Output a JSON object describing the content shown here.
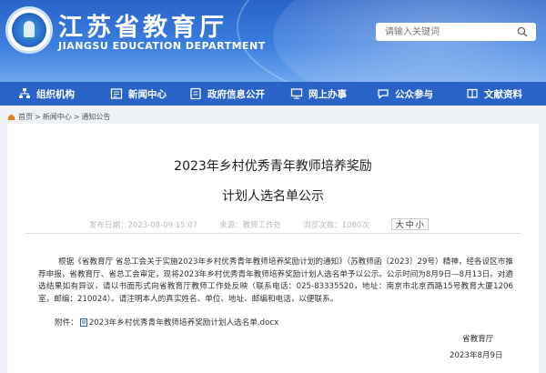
{
  "header": {
    "title": "江苏省教育厅",
    "subtitle": "JIANGSU EDUCATION DEPARTMENT",
    "search_placeholder": "请输入关键词"
  },
  "nav": [
    {
      "label": "组织机构",
      "icon": "org-icon"
    },
    {
      "label": "新闻中心",
      "icon": "news-icon"
    },
    {
      "label": "政府信息公开",
      "icon": "info-icon"
    },
    {
      "label": "网上办事",
      "icon": "computer-icon"
    },
    {
      "label": "公众参与",
      "icon": "chat-icon"
    },
    {
      "label": "文献资料",
      "icon": "book-icon"
    }
  ],
  "breadcrumb": [
    "首页",
    "新闻中心",
    "通知公告"
  ],
  "article": {
    "title_line1": "2023年乡村优秀青年教师培养奖励",
    "title_line2": "计划人选名单公示",
    "published": "发布日期：2023-08-09 15:07",
    "source": "来源：教师工作处",
    "views": "浏览次数：1080次",
    "font_big": "大",
    "font_mid": "中",
    "font_small": "小",
    "body": "根据《省教育厅 省总工会关于实施2023年乡村优秀青年教师培养奖励计划的通知》（苏教师函〔2023〕29号）精神，经各设区市推荐申报，省教育厅、省总工会审定，现将2023年乡村优秀青年教师培养奖励计划人选名单予以公示。公示时间为8月9日—8月13日。对遴选结果如有异议，请以书面形式向省教育厅教师工作处反映（联系电话：025-83335520，地址：南京市北京西路15号教育大厦1206室，邮编：210024）。请注明本人的真实姓名、单位、地址、邮编和电话，以便联系。",
    "attachment_label": "附件：",
    "attachment_file": "2023年乡村优秀青年教师培养奖励计划人选名单.docx",
    "signature": "省教育厅",
    "date": "2023年8月9日"
  }
}
